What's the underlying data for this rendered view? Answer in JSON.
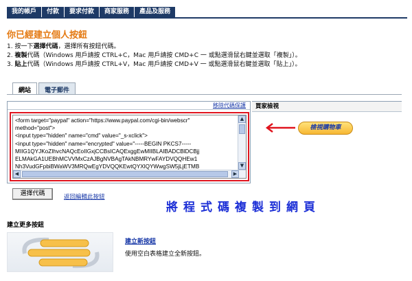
{
  "nav": {
    "items": [
      "我的帳戶",
      "付款",
      "要求付款",
      "商家服務",
      "產品及服務"
    ]
  },
  "page": {
    "title": "你已經建立個人按鈕"
  },
  "steps": [
    {
      "num": "1.",
      "pre": "按一下",
      "key": "選擇代碼",
      "post": "，選擇所有按鈕代碼。"
    },
    {
      "num": "2.",
      "pre": "",
      "key": "複製",
      "post": "代碼（Windows 用戶請按 CTRL+C，Mac 用戶請按 CMD+C 一 或點選滑鼠右鍵並選取「複製」）。"
    },
    {
      "num": "3.",
      "pre": "",
      "key": "貼上",
      "post": "代碼（Windows 用戶請按 CTRL+V，Mac 用戶請按 CMD+V 一 或點選滑鼠右鍵並選取「貼上」）。"
    }
  ],
  "tabs": [
    "網站",
    "電子郵件"
  ],
  "code_panel": {
    "remove_protection": "移除代碼保護",
    "lines": [
      "<form target=\"paypal\" action=\"https://www.paypal.com/cgi-bin/webscr\"",
      "method=\"post\">",
      "<input type=\"hidden\" name=\"cmd\" value=\"_s-xclick\">",
      "<input type=\"hidden\" name=\"encrypted\" value=\"-----BEGIN PKCS7-----",
      "MIIG1QYJKoZIhvcNAQcEoIIGxjCCBsICAQExggEwMIIBLAIBADCBlDCBjj",
      "ELMAkGA1UEBhMCVVMxCzAJBgNVBAgTAkNBMRYwFAYDVQQHEw1",
      "Nh3VudGFpbiBWaWV3MRQwEgYDVQQKEwtQYXlQYWwgSW5jLjETMB"
    ]
  },
  "buyer_preview": {
    "label": "買家檢視",
    "button_label": "檢視購物車"
  },
  "actions": {
    "select_code": "選擇代碼",
    "back_link": "返回編輯此按鈕"
  },
  "annotation": "將程式碼複製到網頁",
  "more": {
    "title": "建立更多按鈕",
    "new_link": "建立新按鈕",
    "new_desc": "使用空白表格建立全新按鈕。"
  },
  "colors": {
    "nav_bg": "#1e3a66",
    "title": "#e47911",
    "link": "#1a3aa8",
    "highlight_border": "#e0141e",
    "annotation": "#1c2fd6"
  }
}
